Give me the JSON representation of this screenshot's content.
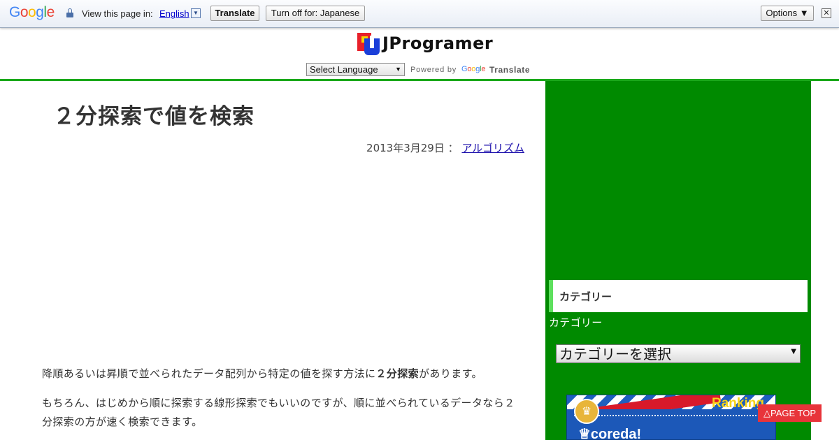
{
  "translate_bar": {
    "logo_letters": [
      {
        "ch": "G",
        "color": "#4285f4"
      },
      {
        "ch": "o",
        "color": "#ea4335"
      },
      {
        "ch": "o",
        "color": "#fbbc05"
      },
      {
        "ch": "g",
        "color": "#4285f4"
      },
      {
        "ch": "l",
        "color": "#34a853"
      },
      {
        "ch": "e",
        "color": "#ea4335"
      }
    ],
    "view_text": "View this page in:",
    "language": "English",
    "language_arrow": "▼",
    "translate_label": "Translate",
    "turn_off_label": "Turn off for: Japanese",
    "options_label": "Options ▼",
    "close_glyph": "✕"
  },
  "header": {
    "site_title": "JProgramer",
    "select_language": "Select Language",
    "select_arrow": "▼",
    "powered_by": "Powered by",
    "google_small": [
      {
        "ch": "G",
        "color": "#4285f4"
      },
      {
        "ch": "o",
        "color": "#ea4335"
      },
      {
        "ch": "o",
        "color": "#fbbc05"
      },
      {
        "ch": "g",
        "color": "#4285f4"
      },
      {
        "ch": "l",
        "color": "#34a853"
      },
      {
        "ch": "e",
        "color": "#ea4335"
      }
    ],
    "translate_word": "Translate",
    "accent_color": "#1aa81a"
  },
  "post": {
    "title": "２分探索で値を検索",
    "date": "2013年3月29日",
    "date_sep": "：",
    "category_link": "アルゴリズム",
    "p1_before": "降順あるいは昇順で並べられたデータ配列から特定の値を探す方法に",
    "p1_bold": "２分探索",
    "p1_after": "があります。",
    "p2": "もちろん、はじめから順に探索する線形探索でもいいのですが、順に並べられているデータなら２分探索の方が速く検索できます。"
  },
  "sidebar": {
    "background": "#008a00",
    "category_heading": "カテゴリー",
    "category_label": "カテゴリー",
    "category_select": "カテゴリーを選択",
    "select_arrow": "▼",
    "ranking_text": "Ranking",
    "ranking_crown": "♛",
    "ranking_brand": "♕coreda!"
  },
  "page_top": "△PAGE TOP"
}
